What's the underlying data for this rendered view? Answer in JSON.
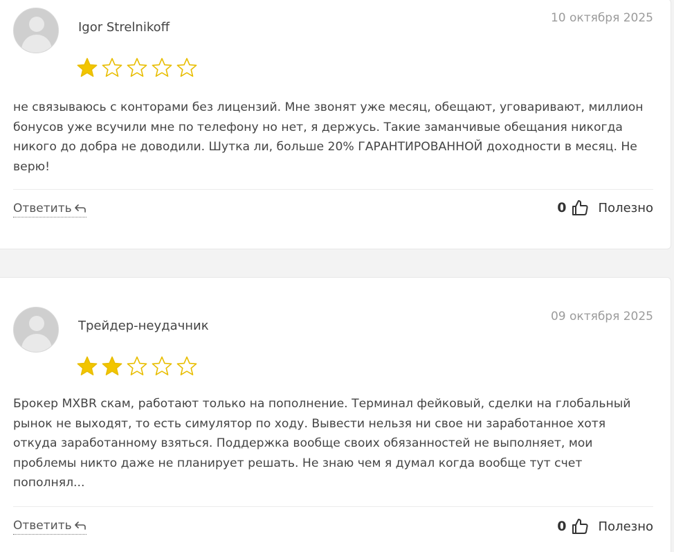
{
  "reviews": [
    {
      "author": "Igor Strelnikoff",
      "date": "10 октября 2025",
      "rating": 1,
      "max_rating": 5,
      "text": "не связываюсь с конторами без лицензий. Мне звонят уже месяц, обещают, уговаривают, миллион бонусов уже всучили мне по телефону но нет, я держусь. Такие заманчивые обещания никогда никого до добра не доводили. Шутка ли, больше 20% ГАРАНТИРОВАННОЙ доходности в месяц. Не верю!",
      "reply_label": "Ответить",
      "helpful_count": "0",
      "helpful_label": "Полезно"
    },
    {
      "author": "Трейдер-неудачник",
      "date": "09 октября 2025",
      "rating": 2,
      "max_rating": 5,
      "text": "Брокер MXBR скам, работают только на пополнение. Терминал фейковый, сделки на глобальный рынок не выходят, то есть симулятор по ходу. Вывести нельзя ни свое ни заработанное хотя откуда заработанному взяться. Поддержка вообще своих обязанностей не выполняет, мои проблемы никто даже не планирует решать. Не знаю чем я думал когда вообще тут счет пополнял...",
      "reply_label": "Ответить",
      "helpful_count": "0",
      "helpful_label": "Полезно"
    }
  ],
  "colors": {
    "star_filled": "#f2c500",
    "star_outline": "#e8bd00"
  },
  "icons": {
    "avatar": "user-avatar-icon",
    "reply": "reply-arrow-icon",
    "helpful": "thumbs-up-icon",
    "star": "star-icon"
  }
}
